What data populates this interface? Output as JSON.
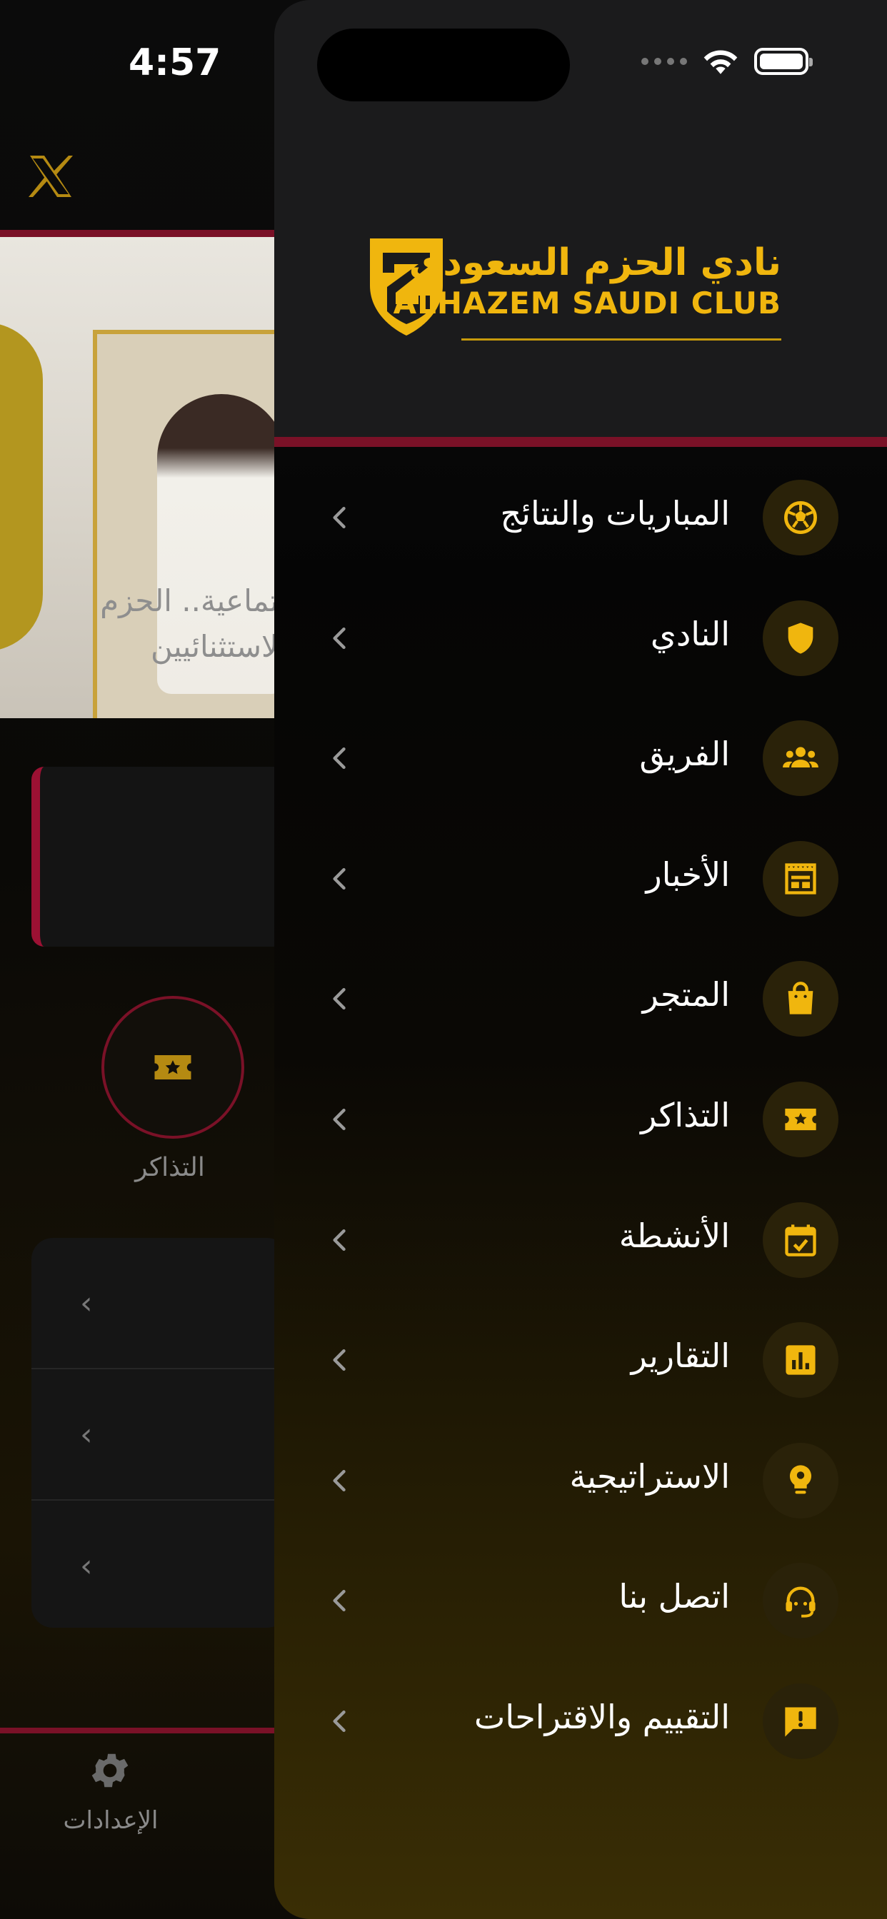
{
  "status_bar": {
    "time": "4:57"
  },
  "background": {
    "hero_caption_line1": "تماعية.. الحزم",
    "hero_caption_line2": "لاستثنائيين",
    "quick_action_label": "التذاكر",
    "tab_settings_label": "الإعدادات"
  },
  "drawer": {
    "logo": {
      "arabic": "نادي الحزم السعودي",
      "english": "ALHAZEM SAUDI CLUB"
    },
    "menu": [
      {
        "label": "المباريات والنتائج",
        "icon": "soccer-ball-icon"
      },
      {
        "label": "النادي",
        "icon": "shield-icon"
      },
      {
        "label": "الفريق",
        "icon": "group-icon"
      },
      {
        "label": "الأخبار",
        "icon": "newspaper-icon"
      },
      {
        "label": "المتجر",
        "icon": "shopping-bag-icon"
      },
      {
        "label": "التذاكر",
        "icon": "ticket-icon"
      },
      {
        "label": "الأنشطة",
        "icon": "calendar-check-icon"
      },
      {
        "label": "التقارير",
        "icon": "report-chart-icon"
      },
      {
        "label": "الاستراتيجية",
        "icon": "lightbulb-icon"
      },
      {
        "label": "اتصل بنا",
        "icon": "headset-icon"
      },
      {
        "label": "التقييم والاقتراحات",
        "icon": "feedback-icon"
      }
    ]
  },
  "colors": {
    "accent": "#F0B60E",
    "brand_red": "#7A1127",
    "icon_bg": "#2A2209"
  }
}
